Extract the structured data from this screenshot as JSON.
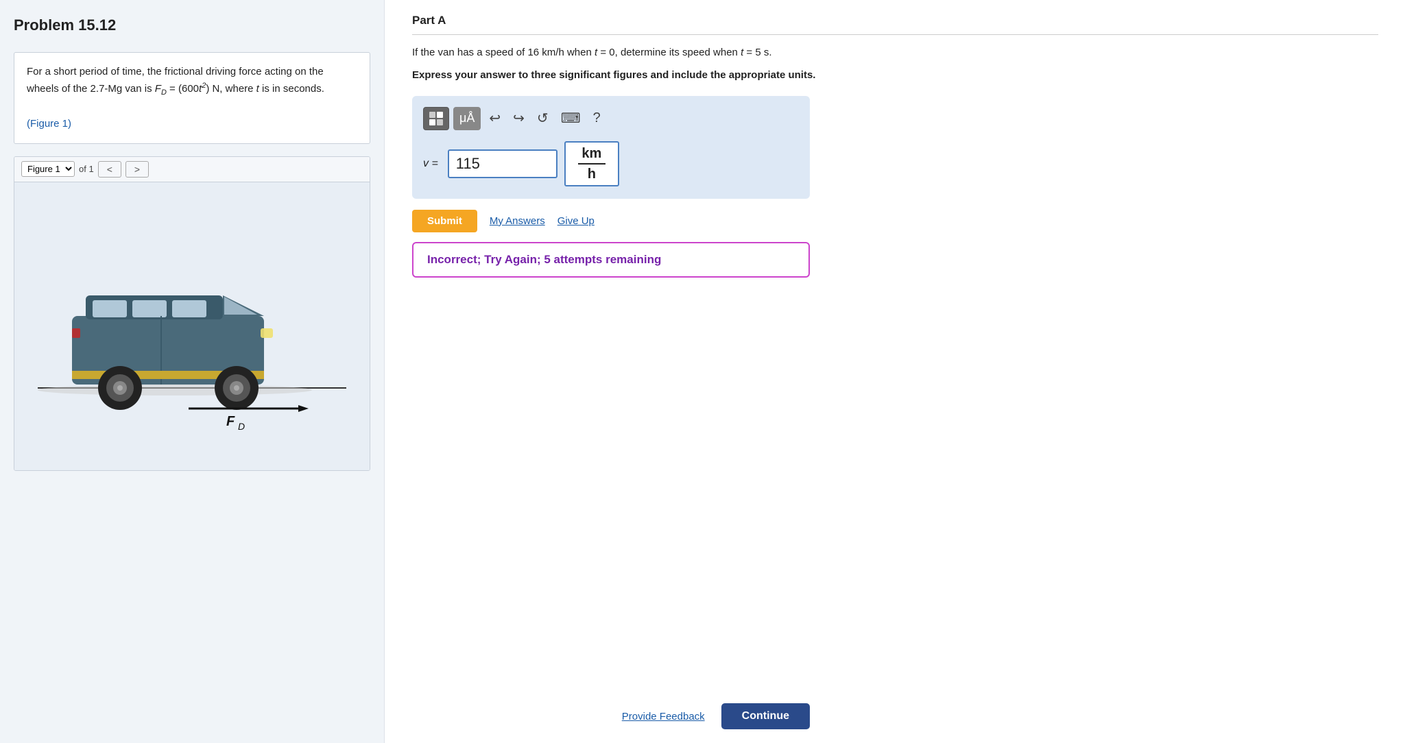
{
  "problem": {
    "title": "Problem 15.12",
    "description_line1": "For a short period of time, the frictional driving force",
    "description_line2": "acting on the wheels of the 2.7-Mg van is F",
    "description_sub": "D",
    "description_line3": " = (600t²)",
    "description_line4": "N, where t is in seconds.",
    "figure_link": "(Figure 1)",
    "figure_label": "Figure 1",
    "figure_of": "of 1"
  },
  "part": {
    "label": "Part A",
    "question": "If the van has a speed of 16 km/h when t = 0, determine its speed when t = 5 s.",
    "instruction": "Express your answer to three significant figures and include the appropriate units.",
    "answer_value": "115",
    "unit_numerator": "km",
    "unit_denominator": "h",
    "var_label": "v =",
    "submit_label": "Submit",
    "my_answers_label": "My Answers",
    "give_up_label": "Give Up",
    "feedback_text": "Incorrect; Try Again; 5 attempts remaining",
    "provide_feedback_label": "Provide Feedback",
    "continue_label": "Continue"
  },
  "toolbar": {
    "undo_label": "↩",
    "redo_label": "↪",
    "reset_label": "↺",
    "keyboard_label": "⌨",
    "help_label": "?"
  },
  "colors": {
    "accent_blue": "#2a4a8a",
    "link_blue": "#1a5ca8",
    "orange": "#f5a623",
    "purple_border": "#cc44cc",
    "purple_text": "#7722aa",
    "toolbar_bg": "#888"
  }
}
